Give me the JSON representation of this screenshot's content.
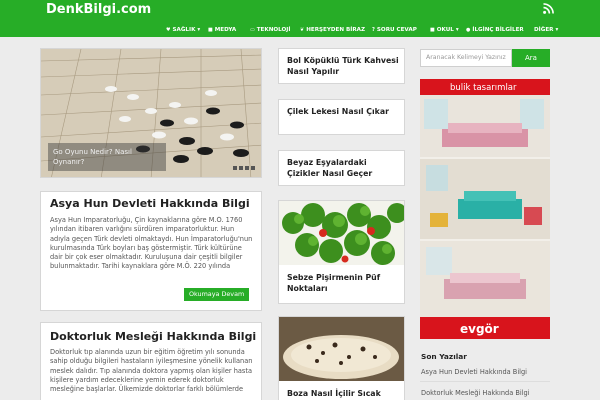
{
  "site": {
    "logo": "DenkBilgi.com"
  },
  "nav": [
    {
      "label": "SAĞLIK",
      "icon": "heart-icon",
      "caret": "▾"
    },
    {
      "label": "MEDYA",
      "icon": "video-icon",
      "caret": ""
    },
    {
      "label": "TEKNOLOJİ",
      "icon": "monitor-icon",
      "caret": ""
    },
    {
      "label": "HERŞEYDEN BİRAZ",
      "icon": "leaf-icon",
      "caret": ""
    },
    {
      "label": "SORU CEVAP",
      "icon": "question-icon",
      "caret": ""
    },
    {
      "label": "OKUL",
      "icon": "book-icon",
      "caret": "▾"
    },
    {
      "label": "İLGİNÇ BİLGİLER",
      "icon": "lightbulb-icon",
      "caret": ""
    },
    {
      "label": "DİĞER",
      "icon": "",
      "caret": "▾"
    }
  ],
  "slider": {
    "caption": "Go Oyunu Nedir? Nasıl Oynanır?"
  },
  "posts": [
    {
      "title": "Asya Hun Devleti Hakkında Bilgi",
      "excerpt": "Asya Hun İmparatorluğu, Çin kaynaklarına göre M.Ö. 1760 yılından itibaren varlığını sürdüren imparatorluktur. Hun adıyla geçen Türk devleti olmaktaydı. Hun İmparatorluğu'nun kurulmasında Türk boyları baş göstermiştir. Türk kültürüne dair bir çok eser olmaktadır. Kuruluşuna dair çeşitli bilgiler bulunmaktadır. Tarihi kaynaklara göre M.Ö. 220 yılında",
      "read_more": "Okumaya Devam"
    },
    {
      "title": "Doktorluk Mesleği Hakkında Bilgi",
      "excerpt": "Doktorluk tıp alanında uzun bir eğitim öğretim yılı sonunda sahip olduğu bilgileri hastaların iyileşmesine yönelik kullanan meslek dalıdır. Tıp alanında doktora yapmış olan kişiler hasta kişilere yardım edeceklerine yemin ederek doktorluk mesleğine başlarlar. Ülkemizde doktorlar farklı bölümlerde"
    }
  ],
  "middle": [
    {
      "title": "Bol Köpüklü Türk Kahvesi Nasıl Yapılır"
    },
    {
      "title": "Çilek Lekesi Nasıl Çıkar"
    },
    {
      "title": "Beyaz Eşyalardaki Çizikler Nasıl Geçer"
    },
    {
      "title": "Sebze Pişirmenin Püf Noktaları"
    },
    {
      "title": "Boza Nasıl İçilir Sıcak"
    }
  ],
  "search": {
    "placeholder": "Aranacak Kelimeyi Yazınız",
    "button": "Ara"
  },
  "ad": {
    "top_text": "bulik tasarımlar",
    "brand": "evgör"
  },
  "recent": {
    "heading": "Son Yazılar",
    "items": [
      "Asya Hun Devleti Hakkında Bilgi",
      "Doktorluk Mesleği Hakkında Bilgi"
    ]
  },
  "colors": {
    "brand_green": "#27ad27",
    "ad_red": "#d8141c"
  }
}
